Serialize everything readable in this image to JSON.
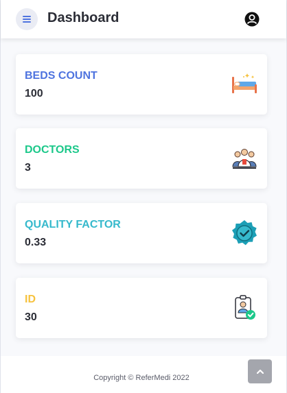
{
  "header": {
    "title": "Dashboard",
    "menu_icon": "hamburger-menu-icon",
    "user_icon": "user-avatar-icon"
  },
  "cards": [
    {
      "label": "BEDS COUNT",
      "value": "100",
      "label_color": "#4e73df",
      "icon": "bed-icon"
    },
    {
      "label": "DOCTORS",
      "value": "3",
      "label_color": "#1cc88a",
      "icon": "doctors-group-icon"
    },
    {
      "label": "QUALITY FACTOR",
      "value": "0.33",
      "label_color": "#36b9cc",
      "icon": "verified-badge-icon"
    },
    {
      "label": "ID",
      "value": "30",
      "label_color": "#f6c23e",
      "icon": "id-badge-icon"
    }
  ],
  "footer": {
    "copyright": "Copyright © ReferMedi 2022"
  },
  "scroll_top_icon": "chevron-up-icon",
  "colors": {
    "background": "#f8f9fc",
    "text_dark": "#2b2d36",
    "menu_bg": "#eaecf4",
    "menu_icon": "#4e73df"
  }
}
